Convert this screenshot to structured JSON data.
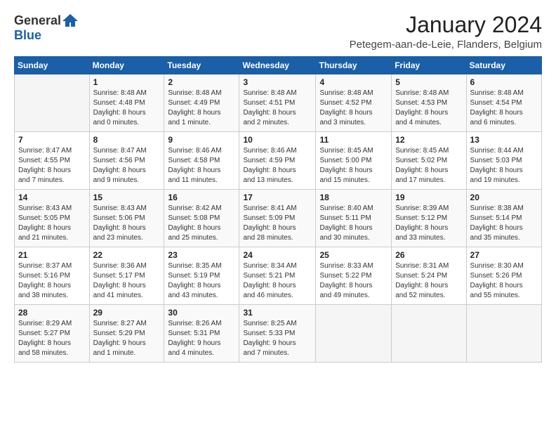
{
  "header": {
    "logo_general": "General",
    "logo_blue": "Blue",
    "title": "January 2024",
    "location": "Petegem-aan-de-Leie, Flanders, Belgium"
  },
  "columns": [
    "Sunday",
    "Monday",
    "Tuesday",
    "Wednesday",
    "Thursday",
    "Friday",
    "Saturday"
  ],
  "weeks": [
    [
      {
        "day": "",
        "info": ""
      },
      {
        "day": "1",
        "info": "Sunrise: 8:48 AM\nSunset: 4:48 PM\nDaylight: 8 hours\nand 0 minutes."
      },
      {
        "day": "2",
        "info": "Sunrise: 8:48 AM\nSunset: 4:49 PM\nDaylight: 8 hours\nand 1 minute."
      },
      {
        "day": "3",
        "info": "Sunrise: 8:48 AM\nSunset: 4:51 PM\nDaylight: 8 hours\nand 2 minutes."
      },
      {
        "day": "4",
        "info": "Sunrise: 8:48 AM\nSunset: 4:52 PM\nDaylight: 8 hours\nand 3 minutes."
      },
      {
        "day": "5",
        "info": "Sunrise: 8:48 AM\nSunset: 4:53 PM\nDaylight: 8 hours\nand 4 minutes."
      },
      {
        "day": "6",
        "info": "Sunrise: 8:48 AM\nSunset: 4:54 PM\nDaylight: 8 hours\nand 6 minutes."
      }
    ],
    [
      {
        "day": "7",
        "info": "Sunrise: 8:47 AM\nSunset: 4:55 PM\nDaylight: 8 hours\nand 7 minutes."
      },
      {
        "day": "8",
        "info": "Sunrise: 8:47 AM\nSunset: 4:56 PM\nDaylight: 8 hours\nand 9 minutes."
      },
      {
        "day": "9",
        "info": "Sunrise: 8:46 AM\nSunset: 4:58 PM\nDaylight: 8 hours\nand 11 minutes."
      },
      {
        "day": "10",
        "info": "Sunrise: 8:46 AM\nSunset: 4:59 PM\nDaylight: 8 hours\nand 13 minutes."
      },
      {
        "day": "11",
        "info": "Sunrise: 8:45 AM\nSunset: 5:00 PM\nDaylight: 8 hours\nand 15 minutes."
      },
      {
        "day": "12",
        "info": "Sunrise: 8:45 AM\nSunset: 5:02 PM\nDaylight: 8 hours\nand 17 minutes."
      },
      {
        "day": "13",
        "info": "Sunrise: 8:44 AM\nSunset: 5:03 PM\nDaylight: 8 hours\nand 19 minutes."
      }
    ],
    [
      {
        "day": "14",
        "info": "Sunrise: 8:43 AM\nSunset: 5:05 PM\nDaylight: 8 hours\nand 21 minutes."
      },
      {
        "day": "15",
        "info": "Sunrise: 8:43 AM\nSunset: 5:06 PM\nDaylight: 8 hours\nand 23 minutes."
      },
      {
        "day": "16",
        "info": "Sunrise: 8:42 AM\nSunset: 5:08 PM\nDaylight: 8 hours\nand 25 minutes."
      },
      {
        "day": "17",
        "info": "Sunrise: 8:41 AM\nSunset: 5:09 PM\nDaylight: 8 hours\nand 28 minutes."
      },
      {
        "day": "18",
        "info": "Sunrise: 8:40 AM\nSunset: 5:11 PM\nDaylight: 8 hours\nand 30 minutes."
      },
      {
        "day": "19",
        "info": "Sunrise: 8:39 AM\nSunset: 5:12 PM\nDaylight: 8 hours\nand 33 minutes."
      },
      {
        "day": "20",
        "info": "Sunrise: 8:38 AM\nSunset: 5:14 PM\nDaylight: 8 hours\nand 35 minutes."
      }
    ],
    [
      {
        "day": "21",
        "info": "Sunrise: 8:37 AM\nSunset: 5:16 PM\nDaylight: 8 hours\nand 38 minutes."
      },
      {
        "day": "22",
        "info": "Sunrise: 8:36 AM\nSunset: 5:17 PM\nDaylight: 8 hours\nand 41 minutes."
      },
      {
        "day": "23",
        "info": "Sunrise: 8:35 AM\nSunset: 5:19 PM\nDaylight: 8 hours\nand 43 minutes."
      },
      {
        "day": "24",
        "info": "Sunrise: 8:34 AM\nSunset: 5:21 PM\nDaylight: 8 hours\nand 46 minutes."
      },
      {
        "day": "25",
        "info": "Sunrise: 8:33 AM\nSunset: 5:22 PM\nDaylight: 8 hours\nand 49 minutes."
      },
      {
        "day": "26",
        "info": "Sunrise: 8:31 AM\nSunset: 5:24 PM\nDaylight: 8 hours\nand 52 minutes."
      },
      {
        "day": "27",
        "info": "Sunrise: 8:30 AM\nSunset: 5:26 PM\nDaylight: 8 hours\nand 55 minutes."
      }
    ],
    [
      {
        "day": "28",
        "info": "Sunrise: 8:29 AM\nSunset: 5:27 PM\nDaylight: 8 hours\nand 58 minutes."
      },
      {
        "day": "29",
        "info": "Sunrise: 8:27 AM\nSunset: 5:29 PM\nDaylight: 9 hours\nand 1 minute."
      },
      {
        "day": "30",
        "info": "Sunrise: 8:26 AM\nSunset: 5:31 PM\nDaylight: 9 hours\nand 4 minutes."
      },
      {
        "day": "31",
        "info": "Sunrise: 8:25 AM\nSunset: 5:33 PM\nDaylight: 9 hours\nand 7 minutes."
      },
      {
        "day": "",
        "info": ""
      },
      {
        "day": "",
        "info": ""
      },
      {
        "day": "",
        "info": ""
      }
    ]
  ]
}
